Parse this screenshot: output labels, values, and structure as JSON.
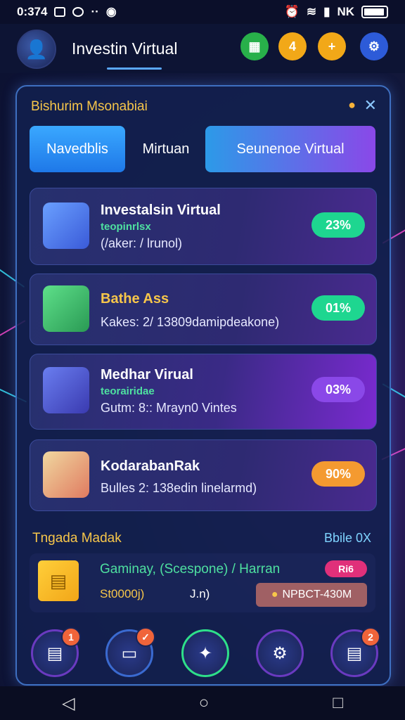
{
  "status_bar": {
    "time": "0:374",
    "right_text": "NK",
    "icons": [
      "notification-icon",
      "notification-icon",
      "dots-icon",
      "circle-icon",
      "signal-icon",
      "alarm-icon",
      "wifi-icon",
      "cell-icon",
      "battery-icon"
    ]
  },
  "header": {
    "title": "Investin Virtual",
    "buttons": [
      {
        "name": "green-action-icon",
        "glyph": "▦",
        "color": "#28b04a"
      },
      {
        "name": "coin-icon",
        "glyph": "4",
        "color": "#f2a818"
      },
      {
        "name": "add-coin-icon",
        "glyph": "+",
        "color": "#f2a818"
      },
      {
        "name": "settings-icon",
        "glyph": "⚙",
        "color": "#2d5bd8"
      }
    ]
  },
  "panel": {
    "title": "Bishurim Msonabiai",
    "close": "✕",
    "tabs": [
      {
        "label": "Navedblis",
        "style": "active"
      },
      {
        "label": "Mirtuan",
        "style": "plain"
      },
      {
        "label": "Seunenoe  Virtual",
        "style": "gradient"
      }
    ],
    "cards": [
      {
        "title": "Investalsin Virtual",
        "sub": "teopinrlsx",
        "detail": "(/aker: / lrunol)",
        "pill": "23%",
        "pill_color": "#1ed690",
        "pill_text": "#ffffff",
        "icon_color": "#4a7ef0"
      },
      {
        "title": "Bathe Ass",
        "sub": "",
        "detail": "Kakes: 2/ 13809damipdeakone)",
        "pill": "01%",
        "pill_color": "#1ed690",
        "pill_text": "#ffffff",
        "icon_color": "#3ac06a"
      },
      {
        "title": "Medhar Virual",
        "sub": "teorairidae",
        "detail": "Gutm: 8:: Mrayn0 Vintes",
        "pill": "03%",
        "pill_color": "#8a48e8",
        "pill_text": "#ffffff",
        "icon_color": "#4a6ad8"
      },
      {
        "title": "KodarabanRak",
        "sub": "",
        "detail": "Bulles 2: 138edin linelarmd)",
        "pill": "90%",
        "pill_color": "#f49a30",
        "pill_text": "#ffffff",
        "icon_color": "#f0a860"
      }
    ],
    "section": {
      "title": "Tngada Madak",
      "link": "Bbile 0X"
    },
    "deal": {
      "title": "Gaminay, (Scespone) / Harran",
      "sub1": "St0000j)",
      "sub2": "J.n)",
      "badge": "Ri6",
      "code": "NPBCT-430M"
    }
  },
  "bottom_nav": [
    {
      "name": "documents-nav-icon",
      "glyph": "▤",
      "badge": "1",
      "ring": "#6a3ac0"
    },
    {
      "name": "wallet-nav-icon",
      "glyph": "▭",
      "badge": "✓",
      "ring": "#3a6ad0"
    },
    {
      "name": "star-nav-icon",
      "glyph": "✦",
      "badge": "",
      "ring": "#2ee08a"
    },
    {
      "name": "network-nav-icon",
      "glyph": "⚙",
      "badge": "",
      "ring": "#6a3ac0"
    },
    {
      "name": "notes-nav-icon",
      "glyph": "▤",
      "badge": "2",
      "ring": "#6a3ac0"
    }
  ],
  "system_nav": {
    "back": "◁",
    "home": "○",
    "recents": "□"
  }
}
